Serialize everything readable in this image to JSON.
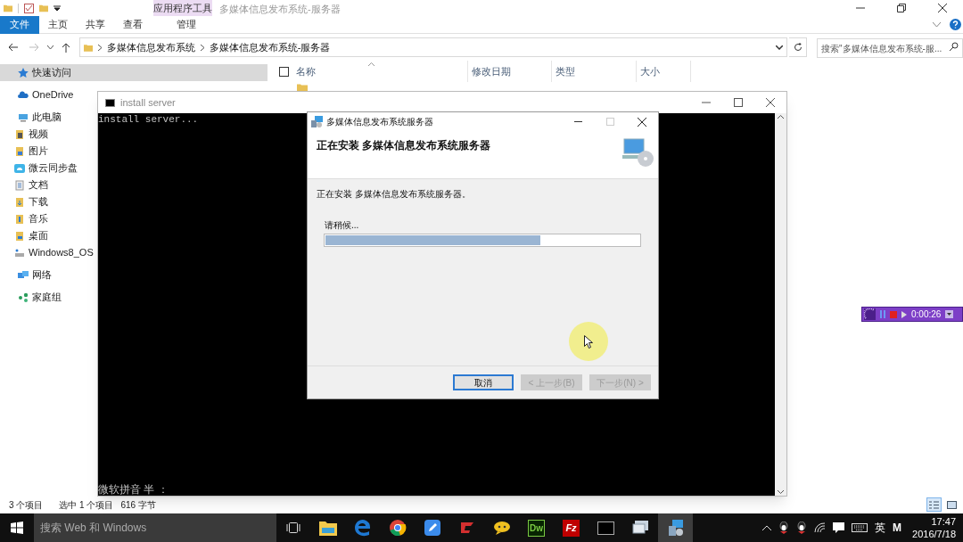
{
  "explorer": {
    "title": "多媒体信息发布系统-服务器",
    "contextual_group": "应用程序工具",
    "ribbon_tabs": [
      {
        "label": "文件",
        "kind": "file",
        "selected": false
      },
      {
        "label": "主页",
        "kind": "tab",
        "selected": false
      },
      {
        "label": "共享",
        "kind": "tab",
        "selected": false
      },
      {
        "label": "查看",
        "kind": "tab",
        "selected": false
      },
      {
        "label": "管理",
        "kind": "contextual",
        "selected": false
      }
    ],
    "breadcrumb": [
      "多媒体信息发布系统",
      "多媒体信息发布系统-服务器"
    ],
    "search": {
      "placeholder": "搜索\"多媒体信息发布系统-服..."
    },
    "sidebar": [
      {
        "label": "快速访问",
        "kind": "star",
        "selected": true
      },
      {
        "label": "OneDrive",
        "kind": "cloud",
        "selected": false
      },
      {
        "label": "此电脑",
        "kind": "pc",
        "selected": false,
        "children": [
          {
            "label": "视频",
            "kind": "video",
            "selected": false
          },
          {
            "label": "图片",
            "kind": "picture",
            "selected": false
          },
          {
            "label": "微云同步盘",
            "kind": "sync",
            "selected": false
          },
          {
            "label": "文档",
            "kind": "doc",
            "selected": false
          },
          {
            "label": "下载",
            "kind": "download",
            "selected": false
          },
          {
            "label": "音乐",
            "kind": "music",
            "selected": false
          },
          {
            "label": "桌面",
            "kind": "desktop",
            "selected": false
          },
          {
            "label": "Windows8_OS",
            "kind": "drive",
            "selected": false
          }
        ]
      },
      {
        "label": "网络",
        "kind": "network",
        "selected": false
      },
      {
        "label": "家庭组",
        "kind": "homegroup",
        "selected": false
      }
    ],
    "columns": [
      "名称",
      "修改日期",
      "类型",
      "大小"
    ],
    "select_all": {
      "checked": false
    },
    "status_bar": [
      "3 个项目",
      "选中 1 个项目",
      "616 字节"
    ],
    "view_modes": [
      {
        "kind": "details",
        "selected": true
      },
      {
        "kind": "tiles",
        "selected": false
      }
    ]
  },
  "console": {
    "title": "install server",
    "lines": [
      "install server..."
    ],
    "ime_status": "微软拼音 半 ："
  },
  "installer": {
    "title": "多媒体信息发布系统服务器",
    "heading": "正在安装 多媒体信息发布系统服务器",
    "message": "正在安装 多媒体信息发布系统服务器。",
    "progress_label": "请稍候...",
    "progress": {
      "level": 0.685
    },
    "buttons": [
      {
        "label": "取消",
        "disabled": false
      },
      {
        "label": "< 上一步(B)",
        "disabled": true
      },
      {
        "label": "下一步(N) >",
        "disabled": true
      }
    ]
  },
  "recorder": {
    "time": "0:00:26"
  },
  "taskbar": {
    "search_placeholder": "搜索 Web 和 Windows",
    "apps": [
      {
        "kind": "explorer",
        "selected": false
      },
      {
        "kind": "edge",
        "selected": false
      },
      {
        "kind": "chrome",
        "selected": false
      },
      {
        "kind": "note",
        "selected": false
      },
      {
        "kind": "red",
        "selected": false
      },
      {
        "kind": "yellow",
        "selected": false
      },
      {
        "kind": "dw",
        "label": "Dw",
        "selected": false
      },
      {
        "kind": "fz",
        "label": "Fz",
        "selected": false
      },
      {
        "kind": "console",
        "selected": false
      },
      {
        "kind": "monitor",
        "selected": false
      },
      {
        "kind": "installer",
        "selected": true
      }
    ],
    "ime": "英",
    "ime_mode": "M",
    "time": "17:47",
    "date": "2016/7/18"
  }
}
